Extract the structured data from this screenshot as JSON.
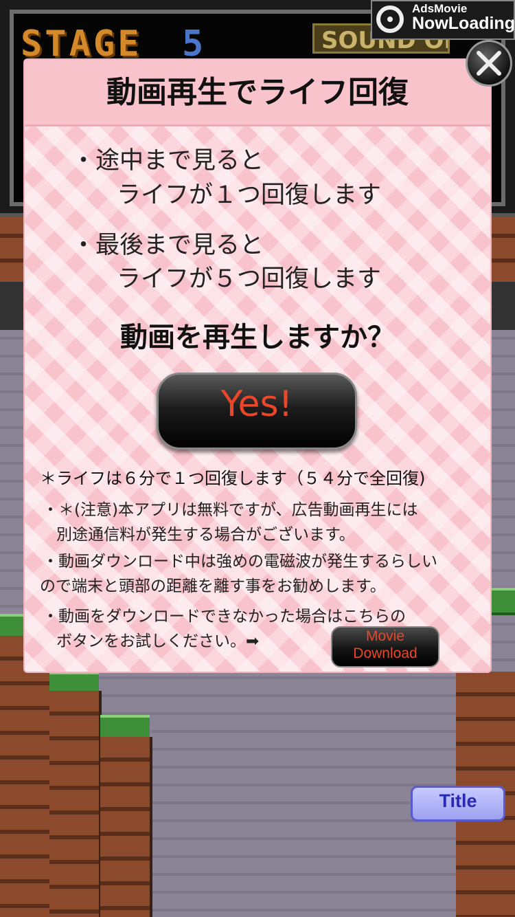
{
  "ads_badge": {
    "title": "AdsMovie",
    "subtitle": "NowLoading"
  },
  "hud": {
    "stage_label": "STAGE",
    "stage_number": "5",
    "sound_button": "SOUND ON"
  },
  "dialog": {
    "title": "動画再生でライフ回復",
    "bullets": [
      {
        "line1": "・途中まで見ると",
        "line2": "ライフが１つ回復します"
      },
      {
        "line1": "・最後まで見ると",
        "line2": "ライフが５つ回復します"
      }
    ],
    "question": "動画を再生しますか？",
    "yes_button": "Yes!",
    "life_note": "＊ライフは６分で１つ回復します（５４分で全回復)",
    "notes": [
      {
        "line1": "・＊(注意)本アプリは無料ですが、広告動画再生には",
        "line2": "別途通信料が発生する場合がございます。"
      },
      {
        "line1": "・動画ダウンロード中は強めの電磁波が発生するらしい",
        "line2": "ので端末と頭部の距離を離す事をお勧めします。"
      },
      {
        "line1": "・動画をダウンロードできなかった場合はこちらの",
        "line2": "ボタンをお試しください。➡"
      }
    ],
    "movie_download": {
      "line1": "Movie",
      "line2": "Download"
    }
  },
  "title_button": "Title",
  "colors": {
    "accent_red": "#e9462a",
    "dialog_pink": "#fbd6dc",
    "title_blue": "#2a2ab0"
  }
}
